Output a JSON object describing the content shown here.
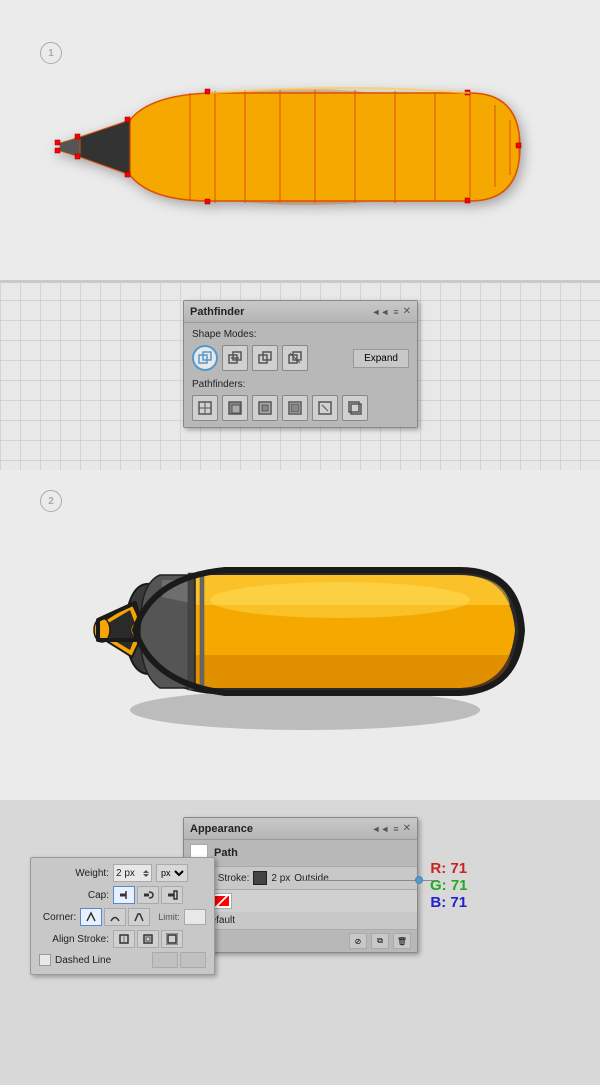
{
  "sections": {
    "section1": {
      "step": "①"
    },
    "section2": {
      "step": "②"
    }
  },
  "pathfinder": {
    "title": "Pathfinder",
    "shape_modes_label": "Shape Modes:",
    "pathfinders_label": "Pathfinders:",
    "expand_label": "Expand",
    "controls_left": "◄◄",
    "controls_right": "≡"
  },
  "appearance": {
    "title": "Appearance",
    "path_label": "Path",
    "stroke_label": "Stroke:",
    "stroke_value": "2 px",
    "stroke_position": "Outside",
    "opacity_label": "ty: Default",
    "controls_left": "◄◄",
    "controls_right": "≡"
  },
  "stroke_panel": {
    "weight_label": "Weight:",
    "weight_value": "2 px",
    "cap_label": "Cap:",
    "corner_label": "Corner:",
    "limit_label": "Limit:",
    "align_label": "Align Stroke:",
    "dashed_label": "Dashed Line"
  },
  "rgb": {
    "r_label": "R: 71",
    "g_label": "G: 71",
    "b_label": "B: 71"
  }
}
